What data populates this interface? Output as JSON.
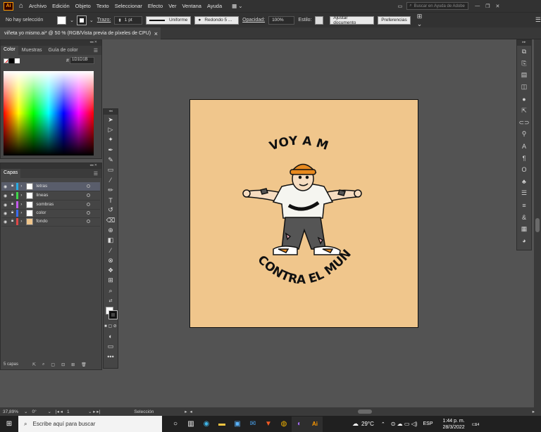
{
  "menubar": {
    "logo": "Ai",
    "items": [
      "Archivo",
      "Edición",
      "Objeto",
      "Texto",
      "Seleccionar",
      "Efecto",
      "Ver",
      "Ventana",
      "Ayuda"
    ],
    "search_placeholder": "Buscar en Ayuda de Adobe"
  },
  "control": {
    "selection": "No hay selección",
    "stroke_label": "Trazo:",
    "stroke_value": "1 pt",
    "profile": "Uniforme",
    "brush": "Redondo 5 ...",
    "opacity_label": "Opacidad:",
    "opacity_value": "100%",
    "style_label": "Estilo:",
    "adjust_btn": "Ajustar documento",
    "prefs_btn": "Preferencias"
  },
  "document": {
    "tab_title": "viñeta yo mismo.ai* @ 50 % (RGB/Vista previa de píxeles de CPU)",
    "close": "×"
  },
  "color_panel": {
    "tabs": [
      "Color",
      "Muestras",
      "Guía de color"
    ],
    "hex_prefix": "#",
    "hex_value": "1D1D1B"
  },
  "layers_panel": {
    "title": "Capas",
    "count": "5 capas",
    "layers": [
      {
        "name": "letras",
        "color": "#29abe2"
      },
      {
        "name": "lineas",
        "color": "#3fd84a"
      },
      {
        "name": "sombras",
        "color": "#c45bf0"
      },
      {
        "name": "color",
        "color": "#3b6cf0"
      },
      {
        "name": "fondo",
        "color": "#e04848"
      }
    ]
  },
  "artwork": {
    "top_text": "VOY A MÍ",
    "bottom_text": "CONTRA EL MUNDO"
  },
  "statusbar": {
    "zoom": "37,89%",
    "angle": "0°",
    "page": "1",
    "tool": "Selección"
  },
  "taskbar": {
    "search_placeholder": "Escribe aquí para buscar",
    "temperature": "29°C",
    "language": "ESP",
    "time": "1:44 p. m.",
    "date": "28/3/2022",
    "notifications": "14"
  }
}
